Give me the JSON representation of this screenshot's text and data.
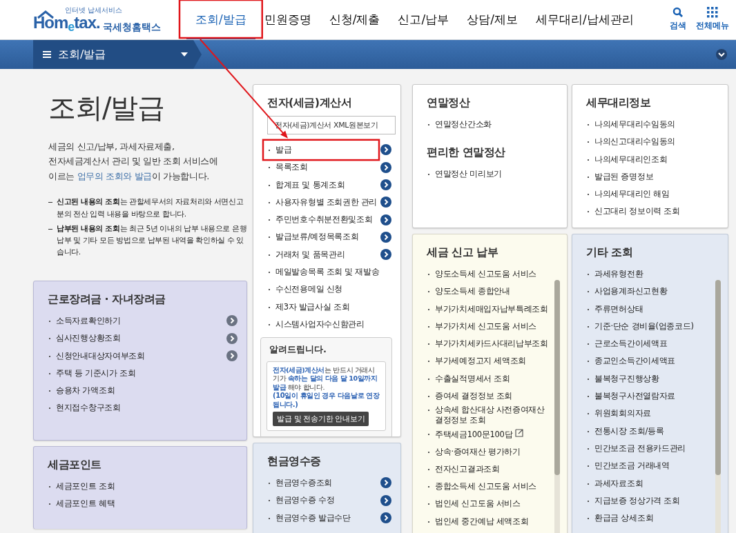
{
  "header": {
    "logo_tagline": "인터넷 납세서비스",
    "logo_text": "Hom$_{e}$tax.",
    "logo_suffix": "국세청홈택스",
    "nav": [
      {
        "label": "조회/발급",
        "selected": true,
        "annotated": true
      },
      {
        "label": "민원증명",
        "selected": false,
        "annotated": false
      },
      {
        "label": "신청/제출",
        "selected": false,
        "annotated": false
      },
      {
        "label": "신고/납부",
        "selected": false,
        "annotated": false
      },
      {
        "label": "상담/제보",
        "selected": false,
        "annotated": false
      },
      {
        "label": "세무대리/납세관리",
        "selected": false,
        "annotated": false
      }
    ],
    "tools": [
      {
        "kind": "search",
        "label": "검색"
      },
      {
        "kind": "menu",
        "label": "전체메뉴"
      }
    ]
  },
  "breadcrumb": {
    "label": "조회/발급"
  },
  "intro": {
    "title": "조회/발급",
    "description_lines": [
      "세금의 신고/납부, 과세자료제출,",
      "전자세금계산서 관리 및 일반 조회 서비스에"
    ],
    "description_start": "이르는 ",
    "description_link": "업무의 조회와 발급",
    "description_end": "이 가능합니다.",
    "notes": [
      {
        "text": "**신고된 내용의 조회**는 관할세무서의 자료처리와 서면신고분의 전산 입력 내용을 바탕으로 합니다."
      },
      {
        "text": "**납부된 내용의 조회**는 최근 5년 이내의 납부 내용으로 은행 납부 및 기타 모든 방법으로 납부된 내역을 확인하실 수 있습니다."
      }
    ]
  },
  "columns": [
    [
      {
        "kind": "lavender",
        "title": "근로장려금 · 자녀장려금",
        "items": [
          {
            "label": "소득자료확인하기",
            "arrow": true,
            "annotated": false
          },
          {
            "label": "심사진행상황조회",
            "arrow": true,
            "annotated": false
          },
          {
            "label": "신청안내대상자여부조회",
            "arrow": true,
            "annotated": false
          },
          {
            "label": "주택 등 기준시가 조회",
            "arrow": false,
            "annotated": false
          },
          {
            "label": "승용차 가액조회",
            "arrow": false,
            "annotated": false
          },
          {
            "label": "현지접수창구조회",
            "arrow": false,
            "annotated": false
          }
        ]
      },
      {
        "kind": "lavender",
        "title": "세금포인트",
        "items": [
          {
            "label": "세금포인트 조회",
            "arrow": false,
            "annotated": false
          },
          {
            "label": "세금포인트 혜택",
            "arrow": false,
            "annotated": false
          }
        ]
      }
    ],
    [
      {
        "kind": "white",
        "title": "전자(세금)계산서",
        "button": "전자(세금)계산서 XML원본보기",
        "items": [
          {
            "label": "발급",
            "arrow": true,
            "annotated": true
          },
          {
            "label": "목록조회",
            "arrow": true,
            "annotated": false
          },
          {
            "label": "합계표 및 통계조회",
            "arrow": true,
            "annotated": false
          },
          {
            "label": "사용자유형별 조회권한 관리",
            "arrow": true,
            "annotated": false
          },
          {
            "label": "주민번호수취분전환및조회",
            "arrow": true,
            "annotated": false
          },
          {
            "label": "발급보류/예정목록조회",
            "arrow": true,
            "annotated": false
          },
          {
            "label": "거래처 및 품목관리",
            "arrow": true,
            "annotated": false
          },
          {
            "label": "메일발송목록 조회 및 재발송",
            "arrow": false,
            "annotated": false
          },
          {
            "label": "수신전용메일 신청",
            "arrow": false,
            "annotated": false
          },
          {
            "label": "제3자 발급사실 조회",
            "arrow": false,
            "annotated": false
          },
          {
            "label": "시스템사업자수신함관리",
            "arrow": false,
            "annotated": false
          }
        ],
        "notice": {
          "title": "알려드립니다.",
          "text": "**전자(세금)계산서**는 반드시 거래시기가 **속하는 달의 다음 달 10일까지 발급** 해야 합니다.",
          "subtext": "(10일이 휴일인 경우 다음날로 연장됩니다.)",
          "button": "발급 및 전송기한 안내보기"
        }
      },
      {
        "kind": "blue",
        "title": "현금영수증",
        "items": [
          {
            "label": "현금영수증조회",
            "arrow": true,
            "annotated": false
          },
          {
            "label": "현금영수증 수정",
            "arrow": true,
            "annotated": false
          },
          {
            "label": "현금영수증 발급수단",
            "arrow": true,
            "annotated": false
          }
        ]
      }
    ],
    [
      {
        "kind": "white",
        "sections": [
          {
            "title": "연말정산",
            "items": [
              {
                "label": "연말정산간소화",
                "arrow": false,
                "annotated": false
              }
            ]
          },
          {
            "title": "편리한 연말정산",
            "items": [
              {
                "label": "연말정산 미리보기",
                "arrow": false,
                "annotated": false
              }
            ]
          }
        ]
      },
      {
        "kind": "cream",
        "title": "세금 신고 납부",
        "scrollbar": true,
        "items": [
          {
            "label": "양도소득세 신고도움 서비스",
            "arrow": false,
            "annotated": false
          },
          {
            "label": "양도소득세 종합안내",
            "arrow": false,
            "annotated": false
          },
          {
            "label": "부가가치세매입자납부특례조회",
            "arrow": false,
            "annotated": false
          },
          {
            "label": "부가가치세 신고도움 서비스",
            "arrow": false,
            "annotated": false
          },
          {
            "label": "부가가치세카드사대리납부조회",
            "arrow": false,
            "annotated": false
          },
          {
            "label": "부가세예정고지 세액조회",
            "arrow": false,
            "annotated": false
          },
          {
            "label": "수출실적명세서 조회",
            "arrow": false,
            "annotated": false
          },
          {
            "label": "증여세 결정정보 조회",
            "arrow": false,
            "annotated": false
          },
          {
            "label": "상속세 합산대상 사전증여재산 결정정보 조회",
            "arrow": false,
            "annotated": false
          },
          {
            "label": "주택세금100문100답",
            "arrow": false,
            "annotated": false,
            "external": true
          },
          {
            "label": "상속·증여재산 평가하기",
            "arrow": false,
            "annotated": false
          },
          {
            "label": "전자신고결과조회",
            "arrow": false,
            "annotated": false
          },
          {
            "label": "종합소득세 신고도움 서비스",
            "arrow": false,
            "annotated": false
          },
          {
            "label": "법인세 신고도움 서비스",
            "arrow": false,
            "annotated": false
          },
          {
            "label": "법인세 중간예납 세액조회",
            "arrow": false,
            "annotated": false
          }
        ]
      }
    ],
    [
      {
        "kind": "white",
        "title": "세무대리정보",
        "items": [
          {
            "label": "나의세무대리수임동의",
            "arrow": false,
            "annotated": false
          },
          {
            "label": "나의신고대리수임동의",
            "arrow": false,
            "annotated": false
          },
          {
            "label": "나의세무대리인조회",
            "arrow": false,
            "annotated": false
          },
          {
            "label": "발급된 증명정보",
            "arrow": false,
            "annotated": false
          },
          {
            "label": "나의세무대리인 해임",
            "arrow": false,
            "annotated": false
          },
          {
            "label": "신고대리 정보이력 조회",
            "arrow": false,
            "annotated": false
          }
        ]
      },
      {
        "kind": "blue",
        "title": "기타 조회",
        "scrollbar": true,
        "items": [
          {
            "label": "과세유형전환",
            "arrow": false,
            "annotated": false
          },
          {
            "label": "사업용계좌신고현황",
            "arrow": false,
            "annotated": false
          },
          {
            "label": "주류면허상태",
            "arrow": false,
            "annotated": false
          },
          {
            "label": "기준·단순 경비율(업종코드)",
            "arrow": false,
            "annotated": false
          },
          {
            "label": "근로소득간이세액표",
            "arrow": false,
            "annotated": false
          },
          {
            "label": "종교인소득간이세액표",
            "arrow": false,
            "annotated": false
          },
          {
            "label": "불복청구진행상황",
            "arrow": false,
            "annotated": false
          },
          {
            "label": "불복청구사전열람자료",
            "arrow": false,
            "annotated": false
          },
          {
            "label": "위원회회의자료",
            "arrow": false,
            "annotated": false
          },
          {
            "label": "전통시장 조회/등록",
            "arrow": false,
            "annotated": false
          },
          {
            "label": "민간보조금 전용카드관리",
            "arrow": false,
            "annotated": false
          },
          {
            "label": "민간보조금 거래내역",
            "arrow": false,
            "annotated": false
          },
          {
            "label": "과세자료조회",
            "arrow": false,
            "annotated": false
          },
          {
            "label": "지급보증 정상가격 조회",
            "arrow": false,
            "annotated": false
          },
          {
            "label": "환급금 상세조회",
            "arrow": false,
            "annotated": false
          }
        ]
      }
    ]
  ]
}
